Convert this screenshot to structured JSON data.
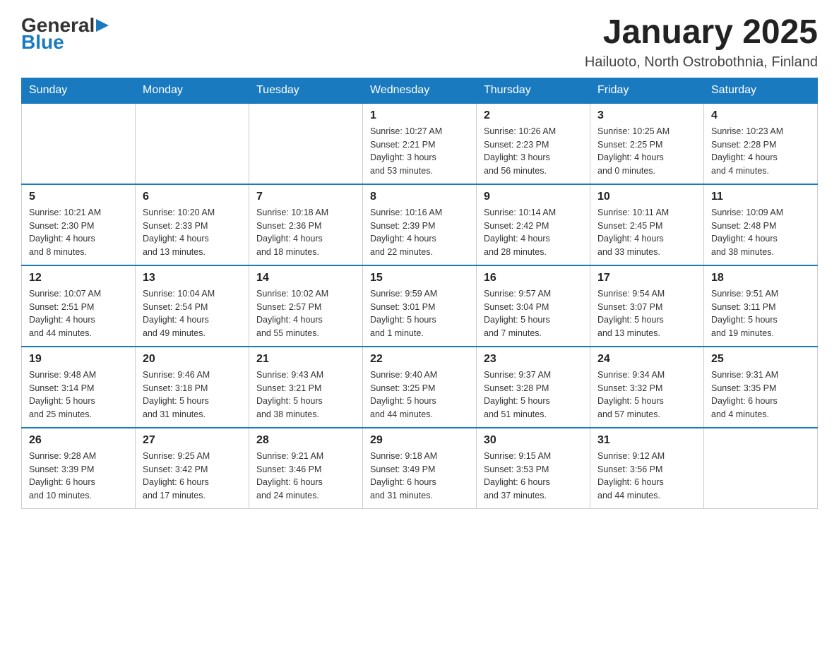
{
  "logo": {
    "general": "General",
    "blue": "Blue"
  },
  "title": "January 2025",
  "subtitle": "Hailuoto, North Ostrobothnia, Finland",
  "headers": [
    "Sunday",
    "Monday",
    "Tuesday",
    "Wednesday",
    "Thursday",
    "Friday",
    "Saturday"
  ],
  "weeks": [
    [
      {
        "day": "",
        "info": ""
      },
      {
        "day": "",
        "info": ""
      },
      {
        "day": "",
        "info": ""
      },
      {
        "day": "1",
        "info": "Sunrise: 10:27 AM\nSunset: 2:21 PM\nDaylight: 3 hours\nand 53 minutes."
      },
      {
        "day": "2",
        "info": "Sunrise: 10:26 AM\nSunset: 2:23 PM\nDaylight: 3 hours\nand 56 minutes."
      },
      {
        "day": "3",
        "info": "Sunrise: 10:25 AM\nSunset: 2:25 PM\nDaylight: 4 hours\nand 0 minutes."
      },
      {
        "day": "4",
        "info": "Sunrise: 10:23 AM\nSunset: 2:28 PM\nDaylight: 4 hours\nand 4 minutes."
      }
    ],
    [
      {
        "day": "5",
        "info": "Sunrise: 10:21 AM\nSunset: 2:30 PM\nDaylight: 4 hours\nand 8 minutes."
      },
      {
        "day": "6",
        "info": "Sunrise: 10:20 AM\nSunset: 2:33 PM\nDaylight: 4 hours\nand 13 minutes."
      },
      {
        "day": "7",
        "info": "Sunrise: 10:18 AM\nSunset: 2:36 PM\nDaylight: 4 hours\nand 18 minutes."
      },
      {
        "day": "8",
        "info": "Sunrise: 10:16 AM\nSunset: 2:39 PM\nDaylight: 4 hours\nand 22 minutes."
      },
      {
        "day": "9",
        "info": "Sunrise: 10:14 AM\nSunset: 2:42 PM\nDaylight: 4 hours\nand 28 minutes."
      },
      {
        "day": "10",
        "info": "Sunrise: 10:11 AM\nSunset: 2:45 PM\nDaylight: 4 hours\nand 33 minutes."
      },
      {
        "day": "11",
        "info": "Sunrise: 10:09 AM\nSunset: 2:48 PM\nDaylight: 4 hours\nand 38 minutes."
      }
    ],
    [
      {
        "day": "12",
        "info": "Sunrise: 10:07 AM\nSunset: 2:51 PM\nDaylight: 4 hours\nand 44 minutes."
      },
      {
        "day": "13",
        "info": "Sunrise: 10:04 AM\nSunset: 2:54 PM\nDaylight: 4 hours\nand 49 minutes."
      },
      {
        "day": "14",
        "info": "Sunrise: 10:02 AM\nSunset: 2:57 PM\nDaylight: 4 hours\nand 55 minutes."
      },
      {
        "day": "15",
        "info": "Sunrise: 9:59 AM\nSunset: 3:01 PM\nDaylight: 5 hours\nand 1 minute."
      },
      {
        "day": "16",
        "info": "Sunrise: 9:57 AM\nSunset: 3:04 PM\nDaylight: 5 hours\nand 7 minutes."
      },
      {
        "day": "17",
        "info": "Sunrise: 9:54 AM\nSunset: 3:07 PM\nDaylight: 5 hours\nand 13 minutes."
      },
      {
        "day": "18",
        "info": "Sunrise: 9:51 AM\nSunset: 3:11 PM\nDaylight: 5 hours\nand 19 minutes."
      }
    ],
    [
      {
        "day": "19",
        "info": "Sunrise: 9:48 AM\nSunset: 3:14 PM\nDaylight: 5 hours\nand 25 minutes."
      },
      {
        "day": "20",
        "info": "Sunrise: 9:46 AM\nSunset: 3:18 PM\nDaylight: 5 hours\nand 31 minutes."
      },
      {
        "day": "21",
        "info": "Sunrise: 9:43 AM\nSunset: 3:21 PM\nDaylight: 5 hours\nand 38 minutes."
      },
      {
        "day": "22",
        "info": "Sunrise: 9:40 AM\nSunset: 3:25 PM\nDaylight: 5 hours\nand 44 minutes."
      },
      {
        "day": "23",
        "info": "Sunrise: 9:37 AM\nSunset: 3:28 PM\nDaylight: 5 hours\nand 51 minutes."
      },
      {
        "day": "24",
        "info": "Sunrise: 9:34 AM\nSunset: 3:32 PM\nDaylight: 5 hours\nand 57 minutes."
      },
      {
        "day": "25",
        "info": "Sunrise: 9:31 AM\nSunset: 3:35 PM\nDaylight: 6 hours\nand 4 minutes."
      }
    ],
    [
      {
        "day": "26",
        "info": "Sunrise: 9:28 AM\nSunset: 3:39 PM\nDaylight: 6 hours\nand 10 minutes."
      },
      {
        "day": "27",
        "info": "Sunrise: 9:25 AM\nSunset: 3:42 PM\nDaylight: 6 hours\nand 17 minutes."
      },
      {
        "day": "28",
        "info": "Sunrise: 9:21 AM\nSunset: 3:46 PM\nDaylight: 6 hours\nand 24 minutes."
      },
      {
        "day": "29",
        "info": "Sunrise: 9:18 AM\nSunset: 3:49 PM\nDaylight: 6 hours\nand 31 minutes."
      },
      {
        "day": "30",
        "info": "Sunrise: 9:15 AM\nSunset: 3:53 PM\nDaylight: 6 hours\nand 37 minutes."
      },
      {
        "day": "31",
        "info": "Sunrise: 9:12 AM\nSunset: 3:56 PM\nDaylight: 6 hours\nand 44 minutes."
      },
      {
        "day": "",
        "info": ""
      }
    ]
  ]
}
